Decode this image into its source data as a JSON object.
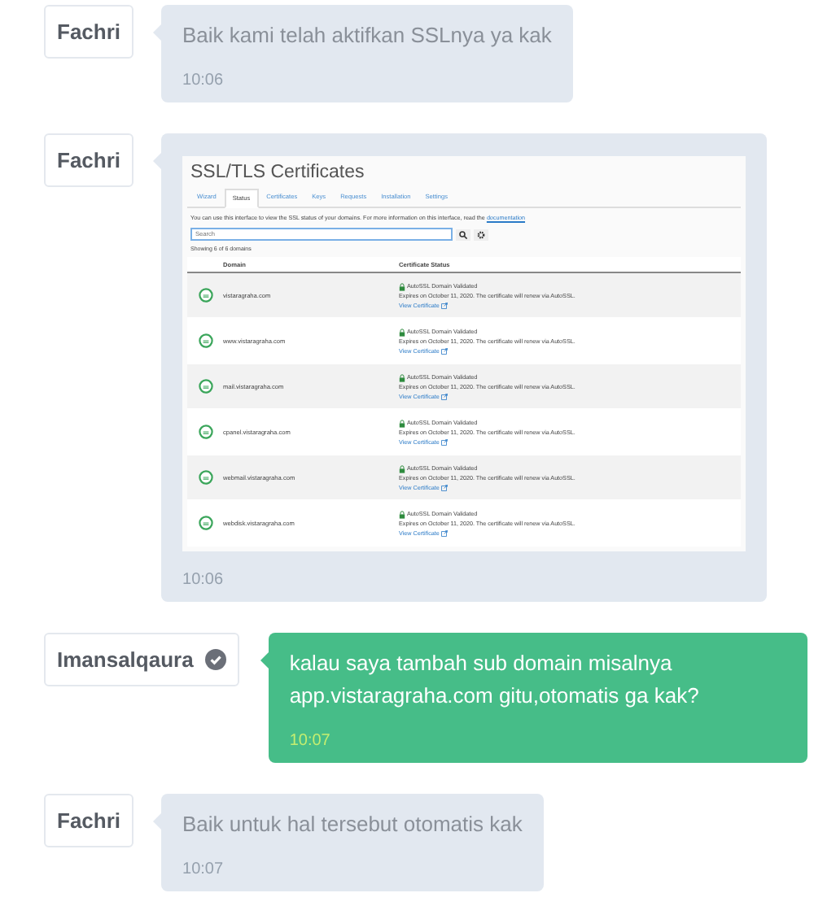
{
  "messages": [
    {
      "sender": "Fachri",
      "outgoing": false,
      "verified": false,
      "kind": "text",
      "text": "Baik kami telah aktifkan SSLnya ya kak",
      "time": "10:06"
    },
    {
      "sender": "Fachri",
      "outgoing": false,
      "verified": false,
      "kind": "screenshot",
      "time": "10:06",
      "screenshot": {
        "title": "SSL/TLS Certificates",
        "tabs": [
          {
            "label": "Wizard",
            "selected": false
          },
          {
            "label": "Status",
            "selected": true
          },
          {
            "label": "Certificates",
            "selected": false
          },
          {
            "label": "Keys",
            "selected": false
          },
          {
            "label": "Requests",
            "selected": false
          },
          {
            "label": "Installation",
            "selected": false
          },
          {
            "label": "Settings",
            "selected": false
          }
        ],
        "description": "You can use this interface to view the SSL status of your domains. For more information on this interface, read the",
        "description_link": "documentation",
        "search": {
          "placeholder": "Search"
        },
        "showing": "Showing 6 of 6 domains",
        "columns": [
          "Domain",
          "Certificate Status"
        ],
        "rows": [
          {
            "domain": "vistaragraha.com",
            "status": "AutoSSL Domain Validated",
            "expiry": "Expires on October 11, 2020. The certificate will renew via AutoSSL.",
            "link": "View Certificate"
          },
          {
            "domain": "www.vistaragraha.com",
            "status": "AutoSSL Domain Validated",
            "expiry": "Expires on October 11, 2020. The certificate will renew via AutoSSL.",
            "link": "View Certificate"
          },
          {
            "domain": "mail.vistaragraha.com",
            "status": "AutoSSL Domain Validated",
            "expiry": "Expires on October 11, 2020. The certificate will renew via AutoSSL.",
            "link": "View Certificate"
          },
          {
            "domain": "cpanel.vistaragraha.com",
            "status": "AutoSSL Domain Validated",
            "expiry": "Expires on October 11, 2020. The certificate will renew via AutoSSL.",
            "link": "View Certificate"
          },
          {
            "domain": "webmail.vistaragraha.com",
            "status": "AutoSSL Domain Validated",
            "expiry": "Expires on October 11, 2020. The certificate will renew via AutoSSL.",
            "link": "View Certificate"
          },
          {
            "domain": "webdisk.vistaragraha.com",
            "status": "AutoSSL Domain Validated",
            "expiry": "Expires on October 11, 2020. The certificate will renew via AutoSSL.",
            "link": "View Certificate"
          }
        ]
      }
    },
    {
      "sender": "Imansalqaura",
      "outgoing": true,
      "verified": true,
      "kind": "text",
      "text": "kalau saya tambah sub domain misalnya app.vistaragraha.com gitu,otomatis ga kak?",
      "time": "10:07"
    },
    {
      "sender": "Fachri",
      "outgoing": false,
      "verified": false,
      "kind": "text",
      "text": "Baik untuk hal tersebut otomatis kak",
      "time": "10:07"
    }
  ]
}
